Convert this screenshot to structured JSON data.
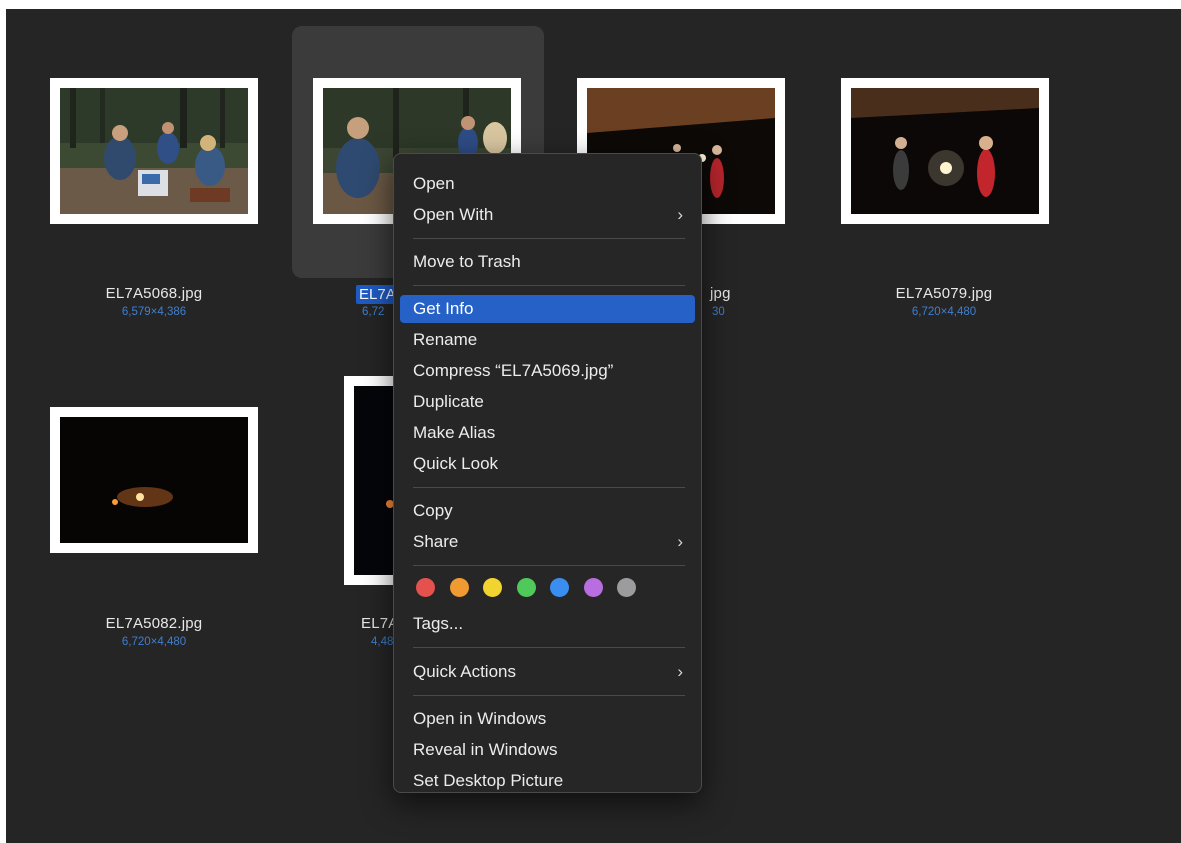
{
  "files": [
    {
      "name": "EL7A5068.jpg",
      "dims": "6,579×4,386"
    },
    {
      "name_visible": "EL7A",
      "dims_visible": "6,72"
    },
    {
      "name_visible": "jpg",
      "dims_visible": "30"
    },
    {
      "name": "EL7A5079.jpg",
      "dims": "6,720×4,480"
    },
    {
      "name": "EL7A5082.jpg",
      "dims": "6,720×4,480"
    },
    {
      "name_visible": "EL7A",
      "dims_visible": "4,48"
    }
  ],
  "menu": {
    "open": "Open",
    "open_with": "Open With",
    "move_to_trash": "Move to Trash",
    "get_info": "Get Info",
    "rename": "Rename",
    "compress": "Compress “EL7A5069.jpg”",
    "duplicate": "Duplicate",
    "make_alias": "Make Alias",
    "quick_look": "Quick Look",
    "copy": "Copy",
    "share": "Share",
    "tags": "Tags...",
    "quick_actions": "Quick Actions",
    "open_in_windows": "Open in Windows",
    "reveal_in_windows": "Reveal in Windows",
    "set_desktop_picture": "Set Desktop Picture",
    "chevron": "›"
  },
  "tag_colors": [
    "#e5514d",
    "#f09a32",
    "#f2d431",
    "#4fca5a",
    "#3a8ef0",
    "#b86de0",
    "#9c9c9e"
  ],
  "colors": {
    "accent": "#2561c7",
    "dims_text": "#3f7fd0"
  }
}
